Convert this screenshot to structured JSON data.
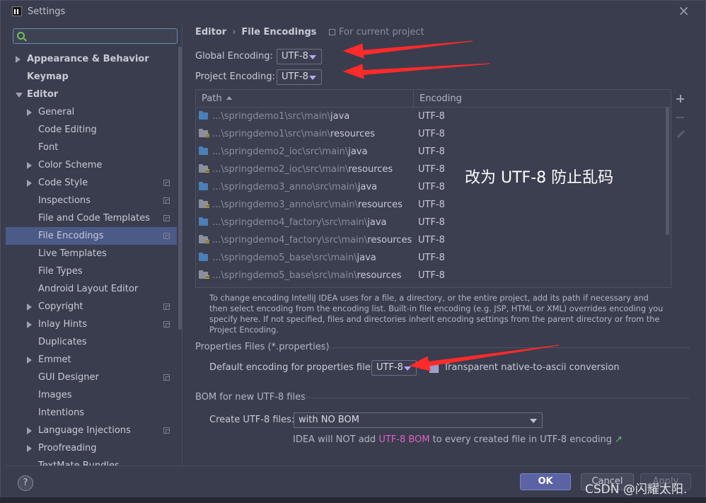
{
  "window": {
    "title": "Settings",
    "close": "×"
  },
  "sidebar": {
    "search": {
      "value": "",
      "placeholder": ""
    },
    "items": [
      {
        "label": "Appearance & Behavior",
        "bold": true,
        "arrow": "right",
        "level": 0
      },
      {
        "label": "Keymap",
        "bold": true,
        "arrow": "",
        "level": 0
      },
      {
        "label": "Editor",
        "bold": true,
        "arrow": "down",
        "level": 0
      },
      {
        "label": "General",
        "arrow": "right",
        "level": 1
      },
      {
        "label": "Code Editing",
        "arrow": "",
        "level": 1
      },
      {
        "label": "Font",
        "arrow": "",
        "level": 1
      },
      {
        "label": "Color Scheme",
        "arrow": "right",
        "level": 1
      },
      {
        "label": "Code Style",
        "arrow": "right",
        "level": 1,
        "copy": true
      },
      {
        "label": "Inspections",
        "arrow": "",
        "level": 1,
        "copy": true
      },
      {
        "label": "File and Code Templates",
        "arrow": "",
        "level": 1,
        "copy": true
      },
      {
        "label": "File Encodings",
        "arrow": "",
        "level": 1,
        "copy": true,
        "selected": true
      },
      {
        "label": "Live Templates",
        "arrow": "",
        "level": 1
      },
      {
        "label": "File Types",
        "arrow": "",
        "level": 1
      },
      {
        "label": "Android Layout Editor",
        "arrow": "",
        "level": 1
      },
      {
        "label": "Copyright",
        "arrow": "right",
        "level": 1,
        "copy": true
      },
      {
        "label": "Inlay Hints",
        "arrow": "right",
        "level": 1,
        "copy": true
      },
      {
        "label": "Duplicates",
        "arrow": "",
        "level": 1
      },
      {
        "label": "Emmet",
        "arrow": "right",
        "level": 1
      },
      {
        "label": "GUI Designer",
        "arrow": "",
        "level": 1,
        "copy": true
      },
      {
        "label": "Images",
        "arrow": "",
        "level": 1
      },
      {
        "label": "Intentions",
        "arrow": "",
        "level": 1
      },
      {
        "label": "Language Injections",
        "arrow": "right",
        "level": 1,
        "copy": true
      },
      {
        "label": "Proofreading",
        "arrow": "right",
        "level": 1
      },
      {
        "label": "TextMate Bundles",
        "arrow": "",
        "level": 1
      }
    ]
  },
  "main": {
    "breadcrumb": {
      "parent": "Editor",
      "sep": "›",
      "current": "File Encodings"
    },
    "scope_label": "For current project",
    "global_encoding": {
      "label": "Global Encoding:",
      "value": "UTF-8"
    },
    "project_encoding": {
      "label": "Project Encoding:",
      "value": "UTF-8"
    },
    "table": {
      "headers": {
        "path": "Path",
        "encoding": "Encoding"
      },
      "rows": [
        {
          "prefix": "...\\springdemo1\\src\\main\\",
          "leaf": "java",
          "type": "src",
          "encoding": "UTF-8"
        },
        {
          "prefix": "...\\springdemo1\\src\\main\\",
          "leaf": "resources",
          "type": "res",
          "encoding": "UTF-8"
        },
        {
          "prefix": "...\\springdemo2_ioc\\src\\main\\",
          "leaf": "java",
          "type": "src",
          "encoding": "UTF-8"
        },
        {
          "prefix": "...\\springdemo2_ioc\\src\\main\\",
          "leaf": "resources",
          "type": "res",
          "encoding": "UTF-8"
        },
        {
          "prefix": "...\\springdemo3_anno\\src\\main\\",
          "leaf": "java",
          "type": "src",
          "encoding": "UTF-8"
        },
        {
          "prefix": "...\\springdemo3_anno\\src\\main\\",
          "leaf": "resources",
          "type": "res",
          "encoding": "UTF-8"
        },
        {
          "prefix": "...\\springdemo4_factory\\src\\main\\",
          "leaf": "java",
          "type": "src",
          "encoding": "UTF-8"
        },
        {
          "prefix": "...\\springdemo4_factory\\src\\main\\",
          "leaf": "resources",
          "type": "res",
          "encoding": "UTF-8"
        },
        {
          "prefix": "...\\springdemo5_base\\src\\main\\",
          "leaf": "java",
          "type": "src",
          "encoding": "UTF-8"
        },
        {
          "prefix": "...\\springdemo5_base\\src\\main\\",
          "leaf": "resources",
          "type": "res",
          "encoding": "UTF-8"
        }
      ],
      "overlay_annotation": "改为 UTF-8  防止乱码"
    },
    "help_text": "To change encoding IntelliJ IDEA uses for a file, a directory, or the entire project, add its path if necessary and then select encoding from the encoding list. Built-in file encoding (e.g. JSP, HTML or XML) overrides encoding you specify here. If not specified, files and directories inherit encoding settings from the parent directory or from the Project Encoding.",
    "properties": {
      "section_title": "Properties Files (*.properties)",
      "default_label": "Default encoding for properties files:",
      "default_value": "UTF-8",
      "transparent_label": "Transparent native-to-ascii conversion",
      "transparent_checked": true
    },
    "bom": {
      "section_title": "BOM for new UTF-8 files",
      "create_label": "Create UTF-8 files:",
      "create_value": "with NO BOM",
      "hint_before": "IDEA will NOT add ",
      "hint_highlight": "UTF-8 BOM",
      "hint_after": " to every created file in UTF-8 encoding",
      "hint_link": "↗"
    }
  },
  "footer": {
    "help": "?",
    "ok": "OK",
    "cancel": "Cancel",
    "apply": "Apply"
  },
  "watermark": "CSDN @闪耀太阳.",
  "colors": {
    "accent": "#5b63a5",
    "selection": "#4b5a87",
    "arrow": "#ff2a2a",
    "highlight": "#e060c0"
  }
}
